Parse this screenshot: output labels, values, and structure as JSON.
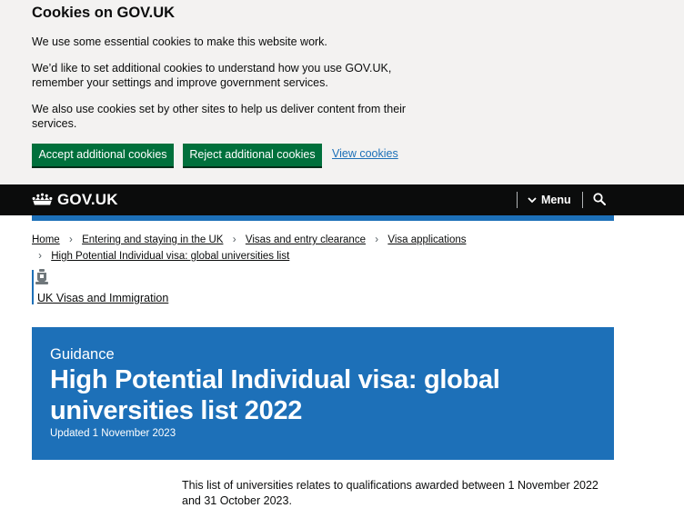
{
  "cookie_banner": {
    "title": "Cookies on GOV.UK",
    "p1": "We use some essential cookies to make this website work.",
    "p2": "We’d like to set additional cookies to understand how you use GOV.UK, remember your settings and improve government services.",
    "p3": "We also use cookies set by other sites to help us deliver content from their services.",
    "accept_label": "Accept additional cookies",
    "reject_label": "Reject additional cookies",
    "view_label": "View cookies"
  },
  "header": {
    "logo_text": "GOV.UK",
    "menu_label": "Menu",
    "icons": [
      "crown-icon",
      "chevron-down-icon",
      "search-icon"
    ]
  },
  "breadcrumb": [
    "Home",
    "Entering and staying in the UK",
    "Visas and entry clearance",
    "Visa applications",
    "High Potential Individual visa: global universities list"
  ],
  "organisation": {
    "name": "UK Visas and Immigration",
    "icon": "royal-crest-icon"
  },
  "title_block": {
    "doc_type": "Guidance",
    "title": "High Potential Individual visa: global universities list 2022",
    "updated": "Updated 1 November 2023"
  },
  "intro": "This list of universities relates to qualifications awarded between 1 November 2022 and 31 October 2023.",
  "colors": {
    "brand_blue": "#1d70b8",
    "button_green": "#00703c",
    "header_black": "#0b0c0c",
    "banner_grey": "#f3f2f1",
    "link_blue": "#1d70b8"
  }
}
